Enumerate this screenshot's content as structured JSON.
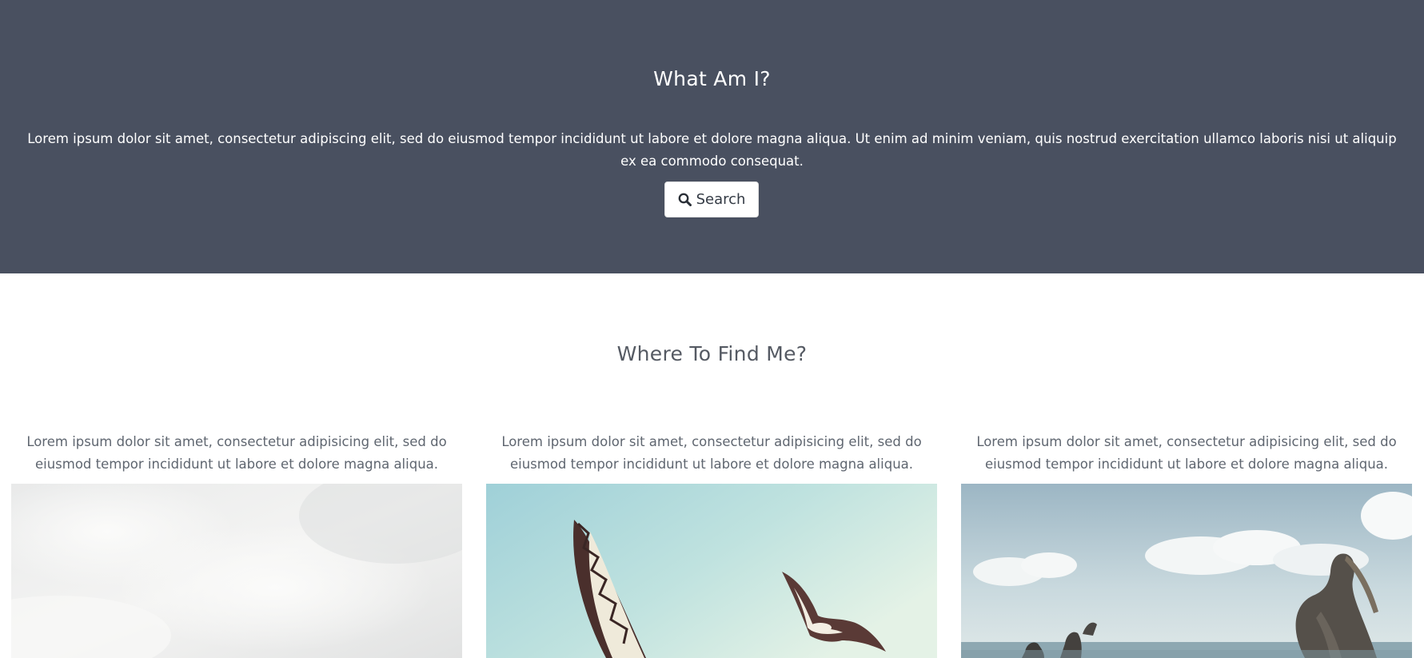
{
  "hero": {
    "title": "What Am I?",
    "text": "Lorem ipsum dolor sit amet, consectetur adipiscing elit, sed do eiusmod tempor incididunt ut labore et dolore magna aliqua. Ut enim ad minim veniam, quis nostrud exercitation ullamco laboris nisi ut aliquip ex ea commodo consequat.",
    "background": "#495060",
    "search_button": {
      "label": "Search",
      "icon": "search-icon"
    }
  },
  "section": {
    "title": "Where To Find Me?",
    "cards": [
      {
        "text": "Lorem ipsum dolor sit amet, consectetur adipisicing elit, sed do eiusmod tempor incididunt ut labore et dolore magna aliqua.",
        "image": "cloudy-sky-photo"
      },
      {
        "text": "Lorem ipsum dolor sit amet, consectetur adipisicing elit, sed do eiusmod tempor incididunt ut labore et dolore magna aliqua.",
        "image": "seagulls-flying-photo"
      },
      {
        "text": "Lorem ipsum dolor sit amet, consectetur adipisicing elit, sed do eiusmod tempor incididunt ut labore et dolore magna aliqua.",
        "image": "pelicans-on-pier-photo"
      }
    ]
  }
}
